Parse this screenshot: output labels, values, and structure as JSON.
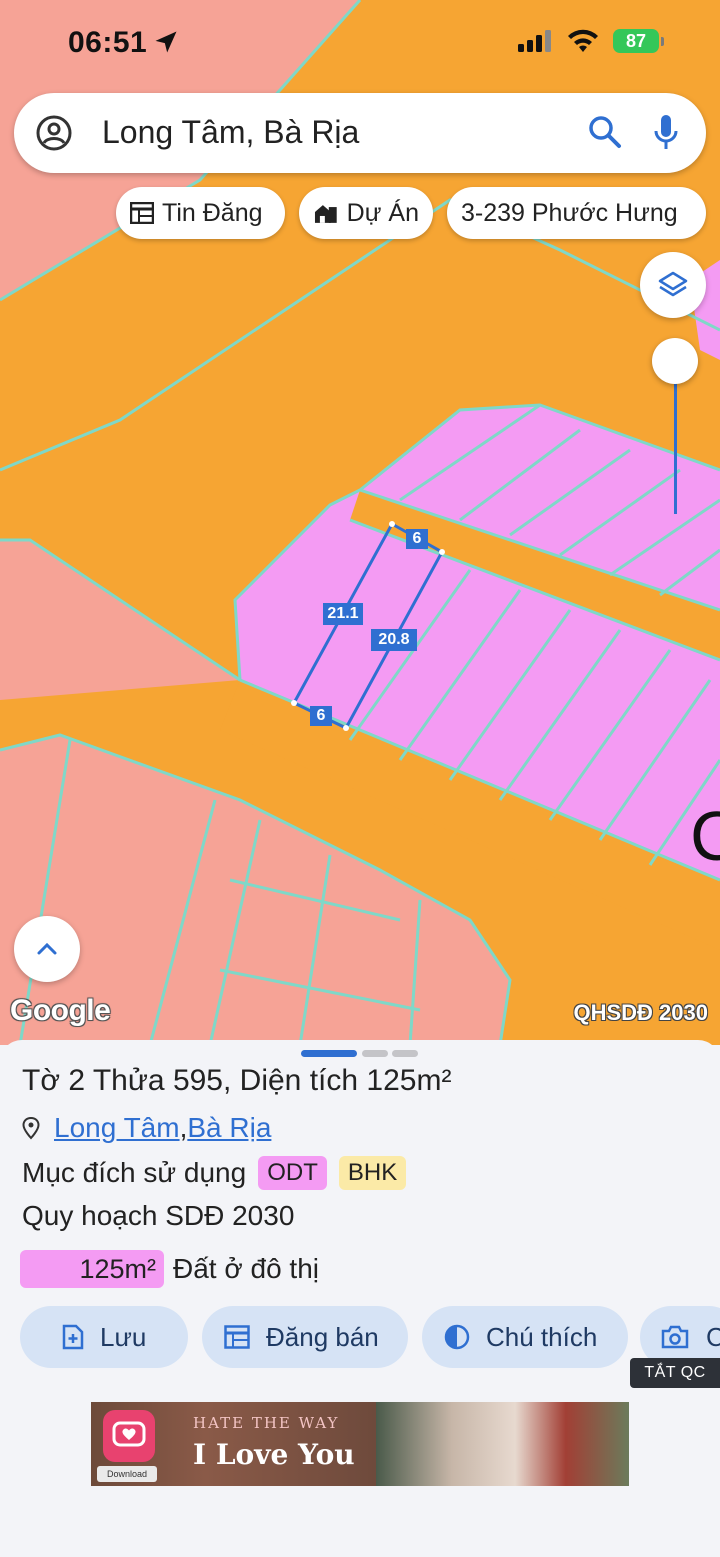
{
  "status_bar": {
    "time": "06:51",
    "battery": "87"
  },
  "search": {
    "query": "Long Tâm, Bà Rịa"
  },
  "chips": [
    {
      "label": "Tin Đăng"
    },
    {
      "label": "Dự Án"
    },
    {
      "label": "3-239 Phước Hưng"
    }
  ],
  "map": {
    "parcel_labels": {
      "top": "6",
      "bottom": "6",
      "left_side": "21.1",
      "right_side": "20.8"
    },
    "google_logo": "Google",
    "layer_label": "QHSDĐ 2030",
    "colors": {
      "residential": "#f49bf3",
      "road": "#f6a533",
      "farmland": "#f6a396",
      "boundary": "#7fd8c8",
      "selection": "#2f6fd1"
    }
  },
  "sheet": {
    "title": {
      "prefix": "Tờ ",
      "sheet_no": "2",
      "mid": " Thửa ",
      "parcel_no": "595",
      "area_label": ", Diện tích ",
      "area_value": "125m²"
    },
    "location": {
      "commune": "Long Tâm",
      "sep": ", ",
      "district": "Bà Rịa"
    },
    "purpose": {
      "label": "Mục đích sử dụng",
      "tags": [
        "ODT",
        "BHK"
      ]
    },
    "plan": "Quy hoạch SDĐ 2030",
    "area_row": {
      "value": "125m²",
      "description": "Đất ở đô thị"
    },
    "actions": [
      {
        "label": "Lưu"
      },
      {
        "label": "Đăng bán"
      },
      {
        "label": "Chú thích"
      },
      {
        "label": "C"
      }
    ],
    "ad_close": "TẮT QC",
    "ad": {
      "small_text": "HATE THE WAY",
      "big_text": "I Love You",
      "download": "Download"
    }
  }
}
